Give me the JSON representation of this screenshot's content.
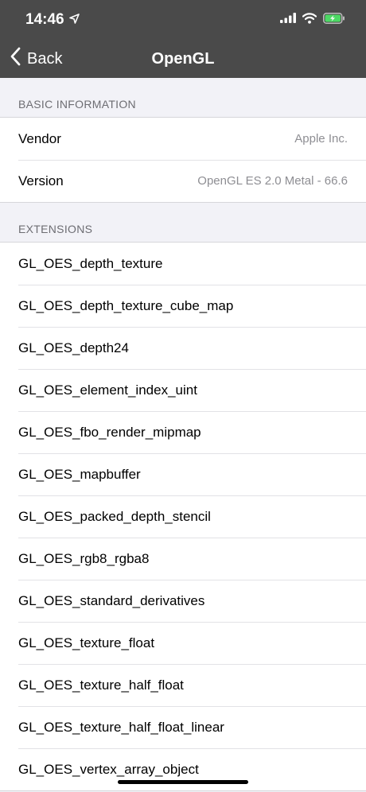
{
  "status_bar": {
    "time": "14:46"
  },
  "nav": {
    "back_label": "Back",
    "title": "OpenGL"
  },
  "basic_info": {
    "header": "BASIC INFORMATION",
    "rows": [
      {
        "label": "Vendor",
        "value": "Apple Inc."
      },
      {
        "label": "Version",
        "value": "OpenGL ES 2.0 Metal - 66.6"
      }
    ]
  },
  "extensions": {
    "header": "EXTENSIONS",
    "items": [
      "GL_OES_depth_texture",
      "GL_OES_depth_texture_cube_map",
      "GL_OES_depth24",
      "GL_OES_element_index_uint",
      "GL_OES_fbo_render_mipmap",
      "GL_OES_mapbuffer",
      "GL_OES_packed_depth_stencil",
      "GL_OES_rgb8_rgba8",
      "GL_OES_standard_derivatives",
      "GL_OES_texture_float",
      "GL_OES_texture_half_float",
      "GL_OES_texture_half_float_linear",
      "GL_OES_vertex_array_object"
    ]
  },
  "colors": {
    "nav_background": "#4a4a4a",
    "battery_charging": "#4cd964"
  },
  "icons": [
    "location-arrow-icon",
    "signal-icon",
    "wifi-icon",
    "battery-icon",
    "chevron-left-icon"
  ]
}
